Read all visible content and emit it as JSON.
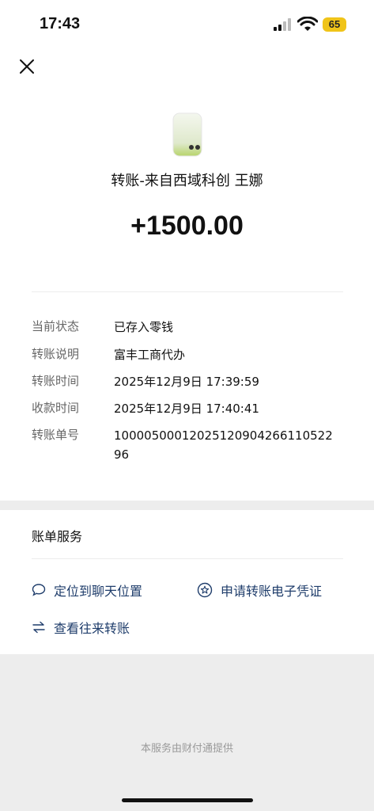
{
  "status_bar": {
    "time": "17:43",
    "battery": "65",
    "icons": [
      "signal-icon",
      "wifi-icon",
      "battery-icon"
    ]
  },
  "header": {
    "close_icon": "close-icon",
    "title": "转账-来自西域科创 王娜",
    "amount": "+1500.00"
  },
  "details": [
    {
      "label": "当前状态",
      "value": "已存入零钱"
    },
    {
      "label": "转账说明",
      "value": "富丰工商代办"
    },
    {
      "label": "转账时间",
      "value": "2025年12月9日 17:39:59"
    },
    {
      "label": "收款时间",
      "value": "2025年12月9日 17:40:41"
    },
    {
      "label": "转账单号",
      "value": "10000500012025120904266110522 96"
    }
  ],
  "bill_service": {
    "title": "账单服务",
    "actions": [
      {
        "label": "定位到聊天位置",
        "icon": "chat-bubble-icon"
      },
      {
        "label": "申请转账电子凭证",
        "icon": "star-badge-icon"
      },
      {
        "label": "查看往来转账",
        "icon": "exchange-arrows-icon"
      }
    ]
  },
  "footer": "本服务由财付通提供",
  "colors": {
    "link": "#1f3d6b",
    "battery": "#f0c419",
    "background": "#ededed"
  }
}
